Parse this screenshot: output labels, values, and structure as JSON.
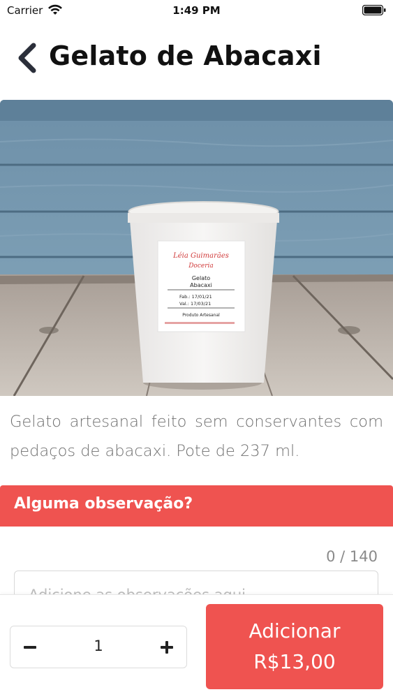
{
  "status_bar": {
    "carrier": "Carrier",
    "time": "1:49 PM"
  },
  "header": {
    "title": "Gelato de Abacaxi"
  },
  "product": {
    "image_label": {
      "brand": "Léia Guimarães",
      "brand_sub": "Doceria",
      "name_line1": "Gelato",
      "name_line2": "Abacaxi",
      "fab": "Fab.: 17/01/21",
      "val": "Val.: 17/03/21",
      "artesanal": "Produto Artesanal"
    },
    "description": "Gelato artesanal feito sem conservantes com pedaços de abacaxi. Pote de 237 ml."
  },
  "observation": {
    "title": "Alguma observação?",
    "counter": "0 / 140",
    "placeholder": "Adicione as observações aqui"
  },
  "footer": {
    "quantity": "1",
    "add_label": "Adicionar",
    "price": "R$13,00"
  },
  "colors": {
    "accent": "#EF5350",
    "text_muted": "#707070"
  }
}
